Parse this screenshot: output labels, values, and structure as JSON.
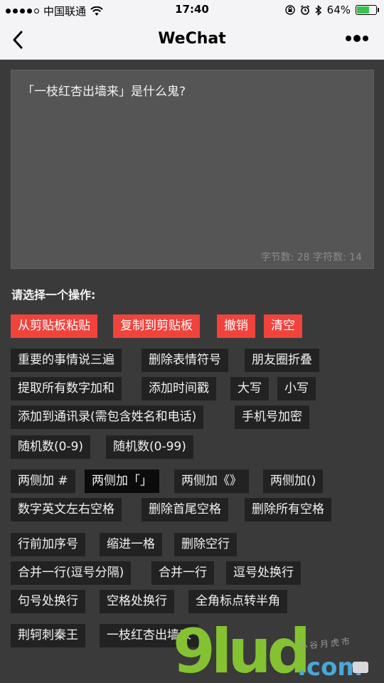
{
  "status": {
    "carrier": "中国联通",
    "time": "17:40",
    "battery": "64%",
    "battery_level": 0.64
  },
  "nav": {
    "title": "WeChat"
  },
  "editor": {
    "text": "「一枝红杏出墙来」是什么鬼?",
    "stats": "字节数: 28 字符数: 14"
  },
  "prompt": "请选择一个操作:",
  "actions": {
    "paste": "从剪贴板粘贴",
    "copy": "复制到剪贴板",
    "undo": "撤销",
    "clear": "清空",
    "repeat3": "重要的事情说三遍",
    "remove_emoji": "删除表情符号",
    "moments_fold": "朋友圈折叠",
    "sum_numbers": "提取所有数字加和",
    "add_timestamp": "添加时间戳",
    "uppercase": "大写",
    "lowercase": "小写",
    "add_contact": "添加到通讯录(需包含姓名和电话)",
    "phone_encrypt": "手机号加密",
    "rand9": "随机数(0-9)",
    "rand99": "随机数(0-99)",
    "wrap_hash": "两侧加 #",
    "wrap_corner": "两侧加「」",
    "wrap_book": "两侧加《》",
    "wrap_paren": "两侧加()",
    "cjk_space": "数字英文左右空格",
    "trim": "删除首尾空格",
    "remove_spaces": "删除所有空格",
    "line_numbers": "行前加序号",
    "indent": "缩进一格",
    "remove_blank": "删除空行",
    "merge_comma": "合并一行(逗号分隔)",
    "merge": "合并一行",
    "comma_newline": "逗号处换行",
    "period_newline": "句号处换行",
    "space_newline": "空格处换行",
    "fullwidth_to_half": "全角标点转半角",
    "sample1": "荆轲刺秦王",
    "sample2": "一枝红杏出墙来"
  },
  "watermark": {
    "main": "9lud",
    "domain": ".com",
    "tagline": "小谷月虎市"
  },
  "colors": {
    "accent_red": "#f0433c",
    "button_dark": "#222222",
    "background": "#3a3a3a"
  }
}
